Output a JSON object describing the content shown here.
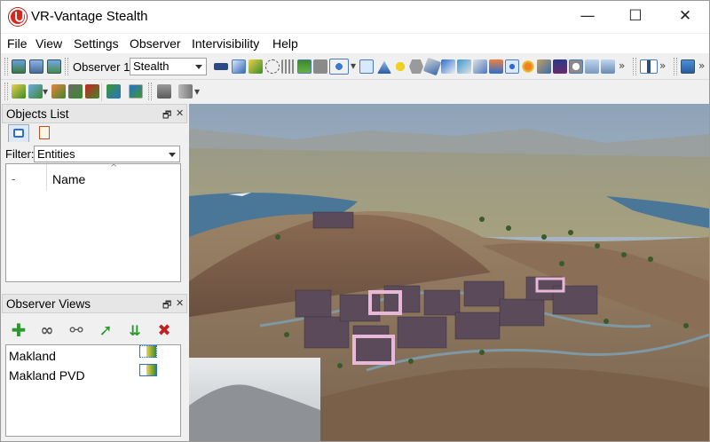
{
  "window": {
    "title": "VR-Vantage Stealth",
    "minimize_glyph": "—",
    "maximize_glyph": "☐",
    "close_glyph": "✕"
  },
  "menu": [
    "File",
    "View",
    "Settings",
    "Observer",
    "Intervisibility",
    "Help"
  ],
  "toolbar": {
    "observer_label": "Observer 1",
    "observer_value": "Stealth",
    "more_glyph": "»"
  },
  "objects_list": {
    "title": "Objects List",
    "float_glyph": "🗗",
    "close_glyph": "✕",
    "filter_label": "Filter:",
    "filter_value": "Entities",
    "col_dash": "-",
    "col_name": "Name",
    "sort_caret": "^"
  },
  "observer_views": {
    "title": "Observer Views",
    "float_glyph": "🗗",
    "close_glyph": "✕",
    "items": [
      "Makland",
      "Makland PVD"
    ]
  },
  "colors": {
    "accent_green": "#3a9a2a",
    "accent_blue": "#2a6fcf",
    "terrain_brown": "#8a6a4a",
    "water_blue": "#4a7698"
  }
}
